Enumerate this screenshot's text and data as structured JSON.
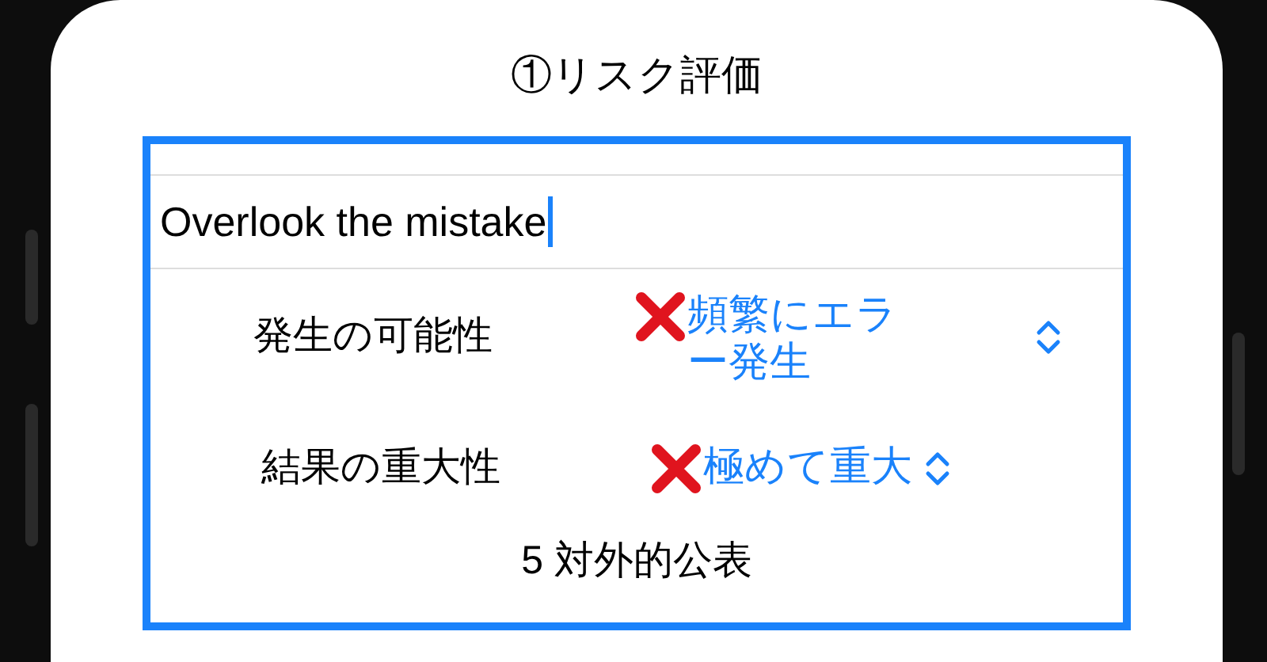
{
  "title": "①リスク評価",
  "text_field": {
    "value": "Overlook the mistake",
    "focused": true
  },
  "pickers": [
    {
      "label": "発生の可能性",
      "value": "頻繁にエラー発生",
      "invalid": true
    },
    {
      "label": "結果の重大性",
      "value": "極めて重大",
      "invalid": true
    }
  ],
  "result": "5 対外的公表"
}
